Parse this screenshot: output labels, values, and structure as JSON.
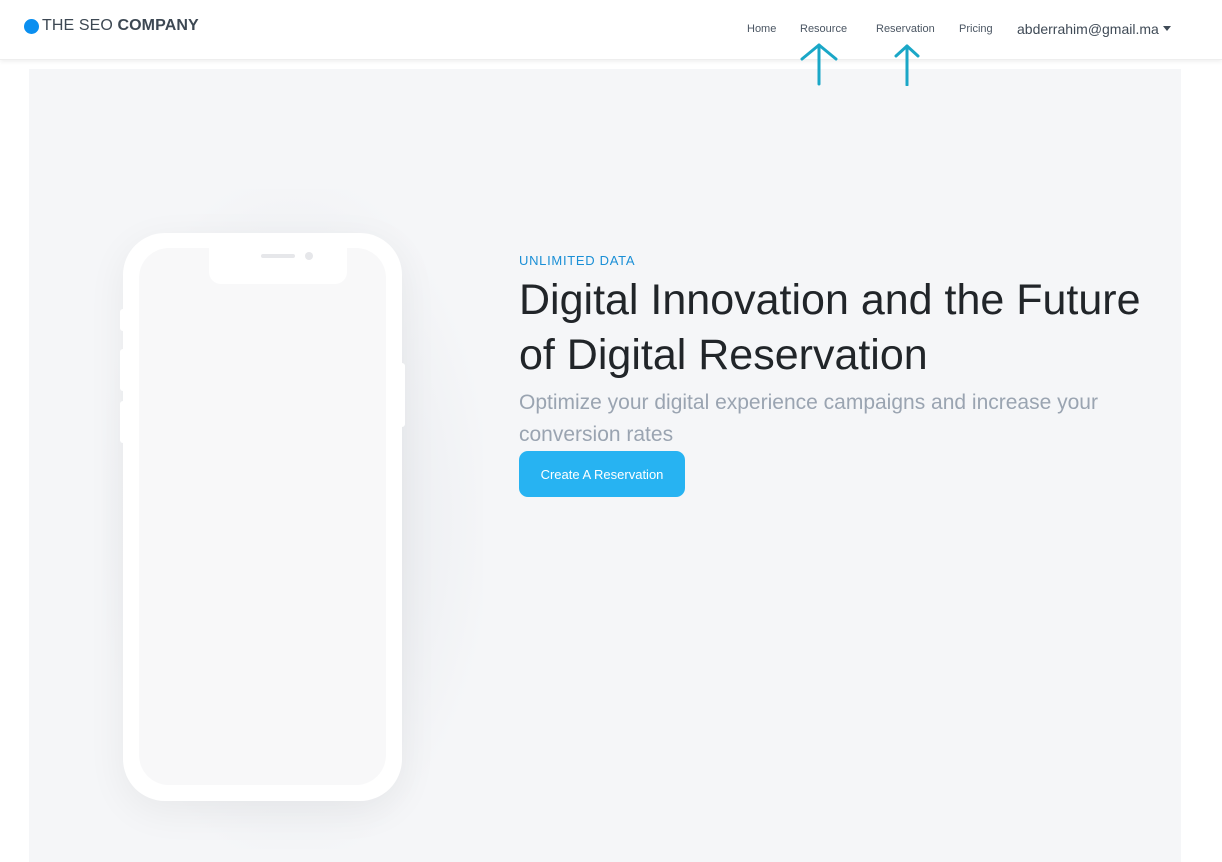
{
  "brand": {
    "name_light": "THE SEO",
    "name_bold": "COMPANY",
    "accent_color": "#0a8ff0"
  },
  "nav": {
    "items": [
      {
        "label": "Home"
      },
      {
        "label": "Resource"
      },
      {
        "label": "Reservation"
      },
      {
        "label": "Pricing"
      }
    ],
    "user": {
      "email": "abderrahim@gmail.ma",
      "icon": "caret-down-icon"
    }
  },
  "annotations": {
    "arrow_color": "#1aa7c7",
    "targets": [
      "Resource",
      "Reservation"
    ]
  },
  "hero": {
    "eyebrow": "UNLIMITED DATA",
    "headline_light": "Digital Innovation and the ",
    "headline_bold": "Future of Digital Reservation",
    "subtext": "Optimize your digital experience campaigns and increase your conversion rates",
    "cta_label": "Create A Reservation",
    "cta_color": "#27b3f2",
    "background": "#f5f6f8"
  }
}
